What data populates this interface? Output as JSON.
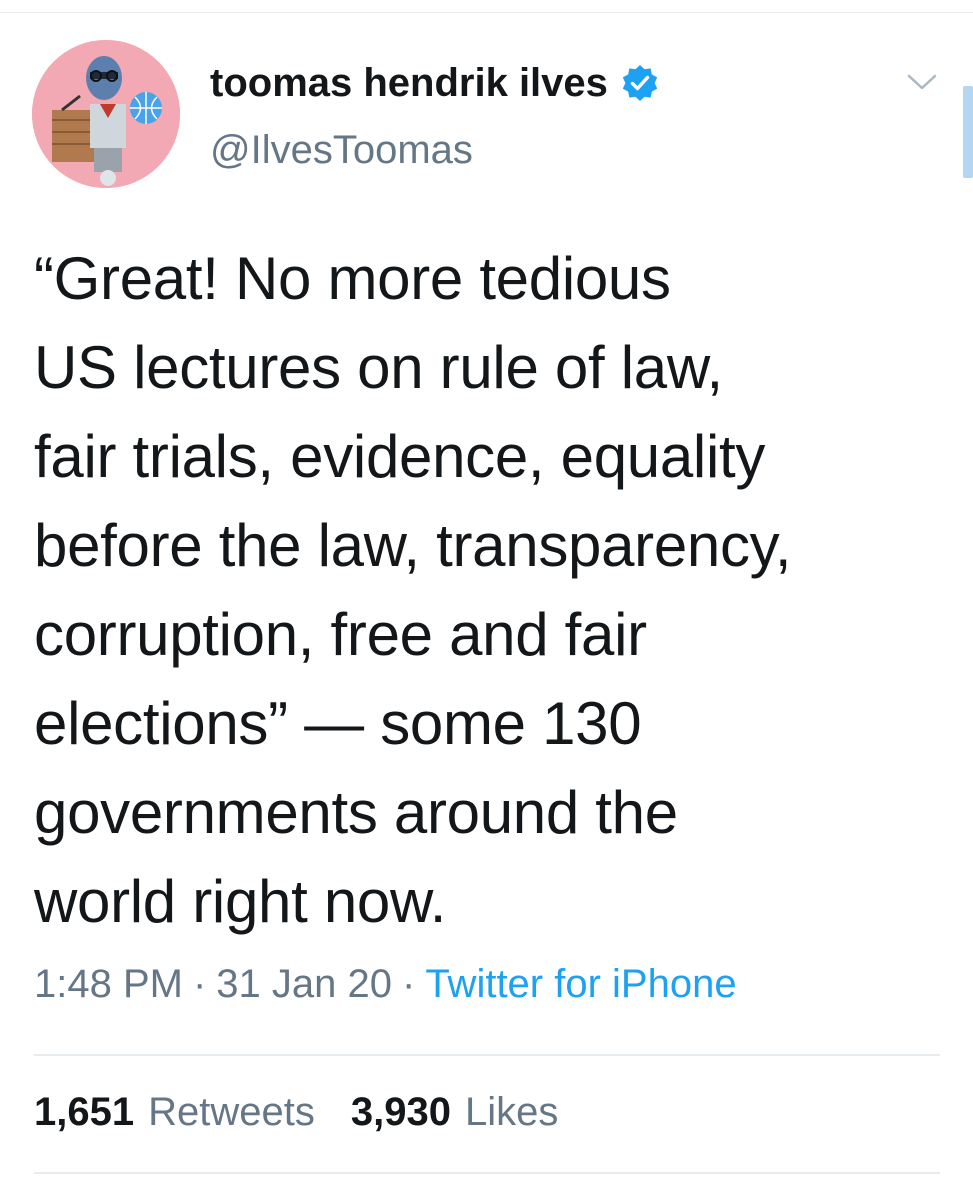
{
  "author": {
    "display_name": "toomas hendrik ilves",
    "handle": "@IlvesToomas",
    "verified": true,
    "avatar_icon": "profile-avatar-icon"
  },
  "tweet": {
    "text": "“Great! No more tedious\nUS lectures on rule of law,\nfair trials, evidence, equality\nbefore the law, transparency,\ncorruption, free and fair\nelections” — some 130\ngovernments around the\nworld right now."
  },
  "meta": {
    "time": "1:48 PM",
    "date": "31 Jan 20",
    "separator": "·",
    "source": "Twitter for iPhone"
  },
  "stats": {
    "retweets_count": "1,651",
    "retweets_label": "Retweets",
    "likes_count": "3,930",
    "likes_label": "Likes"
  },
  "icons": {
    "verified": "verified-badge-icon",
    "more": "chevron-down-icon"
  },
  "colors": {
    "verified_blue": "#1da1f2",
    "text_primary": "#14171a",
    "text_secondary": "#657786",
    "divider": "#e6ecf0"
  }
}
